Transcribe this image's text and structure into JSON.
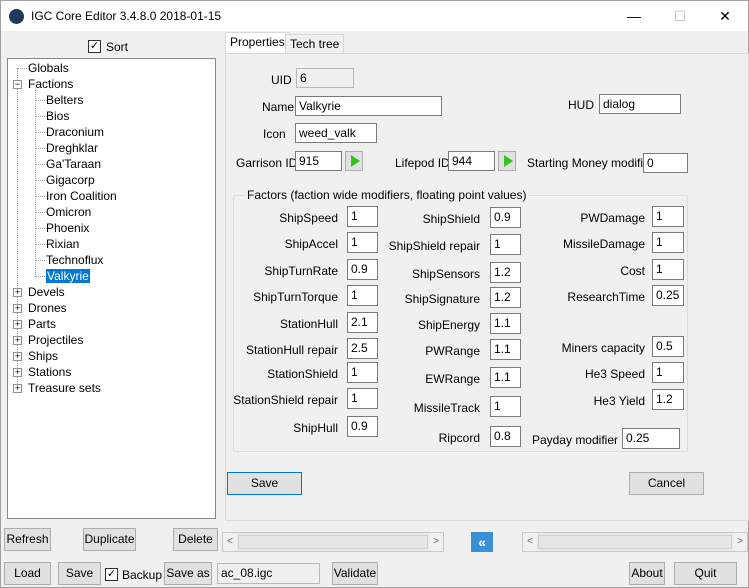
{
  "window": {
    "title": "IGC Core Editor 3.4.8.0 2018-01-15",
    "min": "—",
    "max": "☐",
    "close": "✕"
  },
  "sort": {
    "label": "Sort",
    "checked": "✓"
  },
  "tree": {
    "globals": "Globals",
    "factions": "Factions",
    "faction_items": [
      "Belters",
      "Bios",
      "Draconium",
      "Dreghklar",
      "Ga'Taraan",
      "Gigacorp",
      "Iron Coalition",
      "Omicron",
      "Phoenix",
      "Rixian",
      "Technoflux",
      "Valkyrie"
    ],
    "selected": "Valkyrie",
    "collapsed": [
      "Devels",
      "Drones",
      "Parts",
      "Projectiles",
      "Ships",
      "Stations",
      "Treasure sets"
    ],
    "minus": "−",
    "plus": "+"
  },
  "tabs": [
    "Properties",
    "Tech tree"
  ],
  "props": {
    "uid_label": "UID",
    "uid": "6",
    "name_label": "Name",
    "name": "Valkyrie",
    "hud_label": "HUD",
    "hud": "dialog",
    "icon_label": "Icon",
    "icon": "weed_valk",
    "garrison_label": "Garrison ID",
    "garrison": "915",
    "lifepod_label": "Lifepod ID",
    "lifepod": "944",
    "money_label": "Starting Money modifier",
    "money": "0"
  },
  "factors": {
    "title": "Factors (faction wide modifiers, floating point values)",
    "col1": [
      {
        "label": "ShipSpeed",
        "value": "1"
      },
      {
        "label": "ShipAccel",
        "value": "1"
      },
      {
        "label": "ShipTurnRate",
        "value": "0.9"
      },
      {
        "label": "ShipTurnTorque",
        "value": "1"
      },
      {
        "label": "StationHull",
        "value": "2.1"
      },
      {
        "label": "StationHull repair",
        "value": "2.5"
      },
      {
        "label": "StationShield",
        "value": "1"
      },
      {
        "label": "StationShield repair",
        "value": "1"
      },
      {
        "label": "ShipHull",
        "value": "0.9"
      }
    ],
    "col2": [
      {
        "label": "ShipShield",
        "value": "0.9"
      },
      {
        "label": "ShipShield repair",
        "value": "1"
      },
      {
        "label": "ShipSensors",
        "value": "1.2"
      },
      {
        "label": "ShipSignature",
        "value": "1.2"
      },
      {
        "label": "ShipEnergy",
        "value": "1.1"
      },
      {
        "label": "PWRange",
        "value": "1.1"
      },
      {
        "label": "EWRange",
        "value": "1.1"
      },
      {
        "label": "MissileTrack",
        "value": "1"
      },
      {
        "label": "Ripcord",
        "value": "0.8"
      }
    ],
    "col3": [
      {
        "label": "PWDamage",
        "value": "1"
      },
      {
        "label": "MissileDamage",
        "value": "1"
      },
      {
        "label": "Cost",
        "value": "1"
      },
      {
        "label": "ResearchTime",
        "value": "0.25"
      },
      {
        "label": "Miners capacity",
        "value": "0.5"
      },
      {
        "label": "He3 Speed",
        "value": "1"
      },
      {
        "label": "He3 Yield",
        "value": "1.2"
      },
      {
        "label": "Payday modifier",
        "value": "0.25"
      }
    ]
  },
  "buttons": {
    "save_panel": "Save",
    "cancel": "Cancel",
    "refresh": "Refresh",
    "duplicate": "Duplicate",
    "delete": "Delete",
    "load": "Load",
    "save": "Save",
    "backup": "Backup",
    "backup_checked": "✓",
    "save_as": "Save as",
    "validate": "Validate",
    "about": "About",
    "quit": "Quit"
  },
  "file": "ac_08.igc",
  "scroll": {
    "left": "<",
    "right": ">",
    "fast": "«"
  }
}
